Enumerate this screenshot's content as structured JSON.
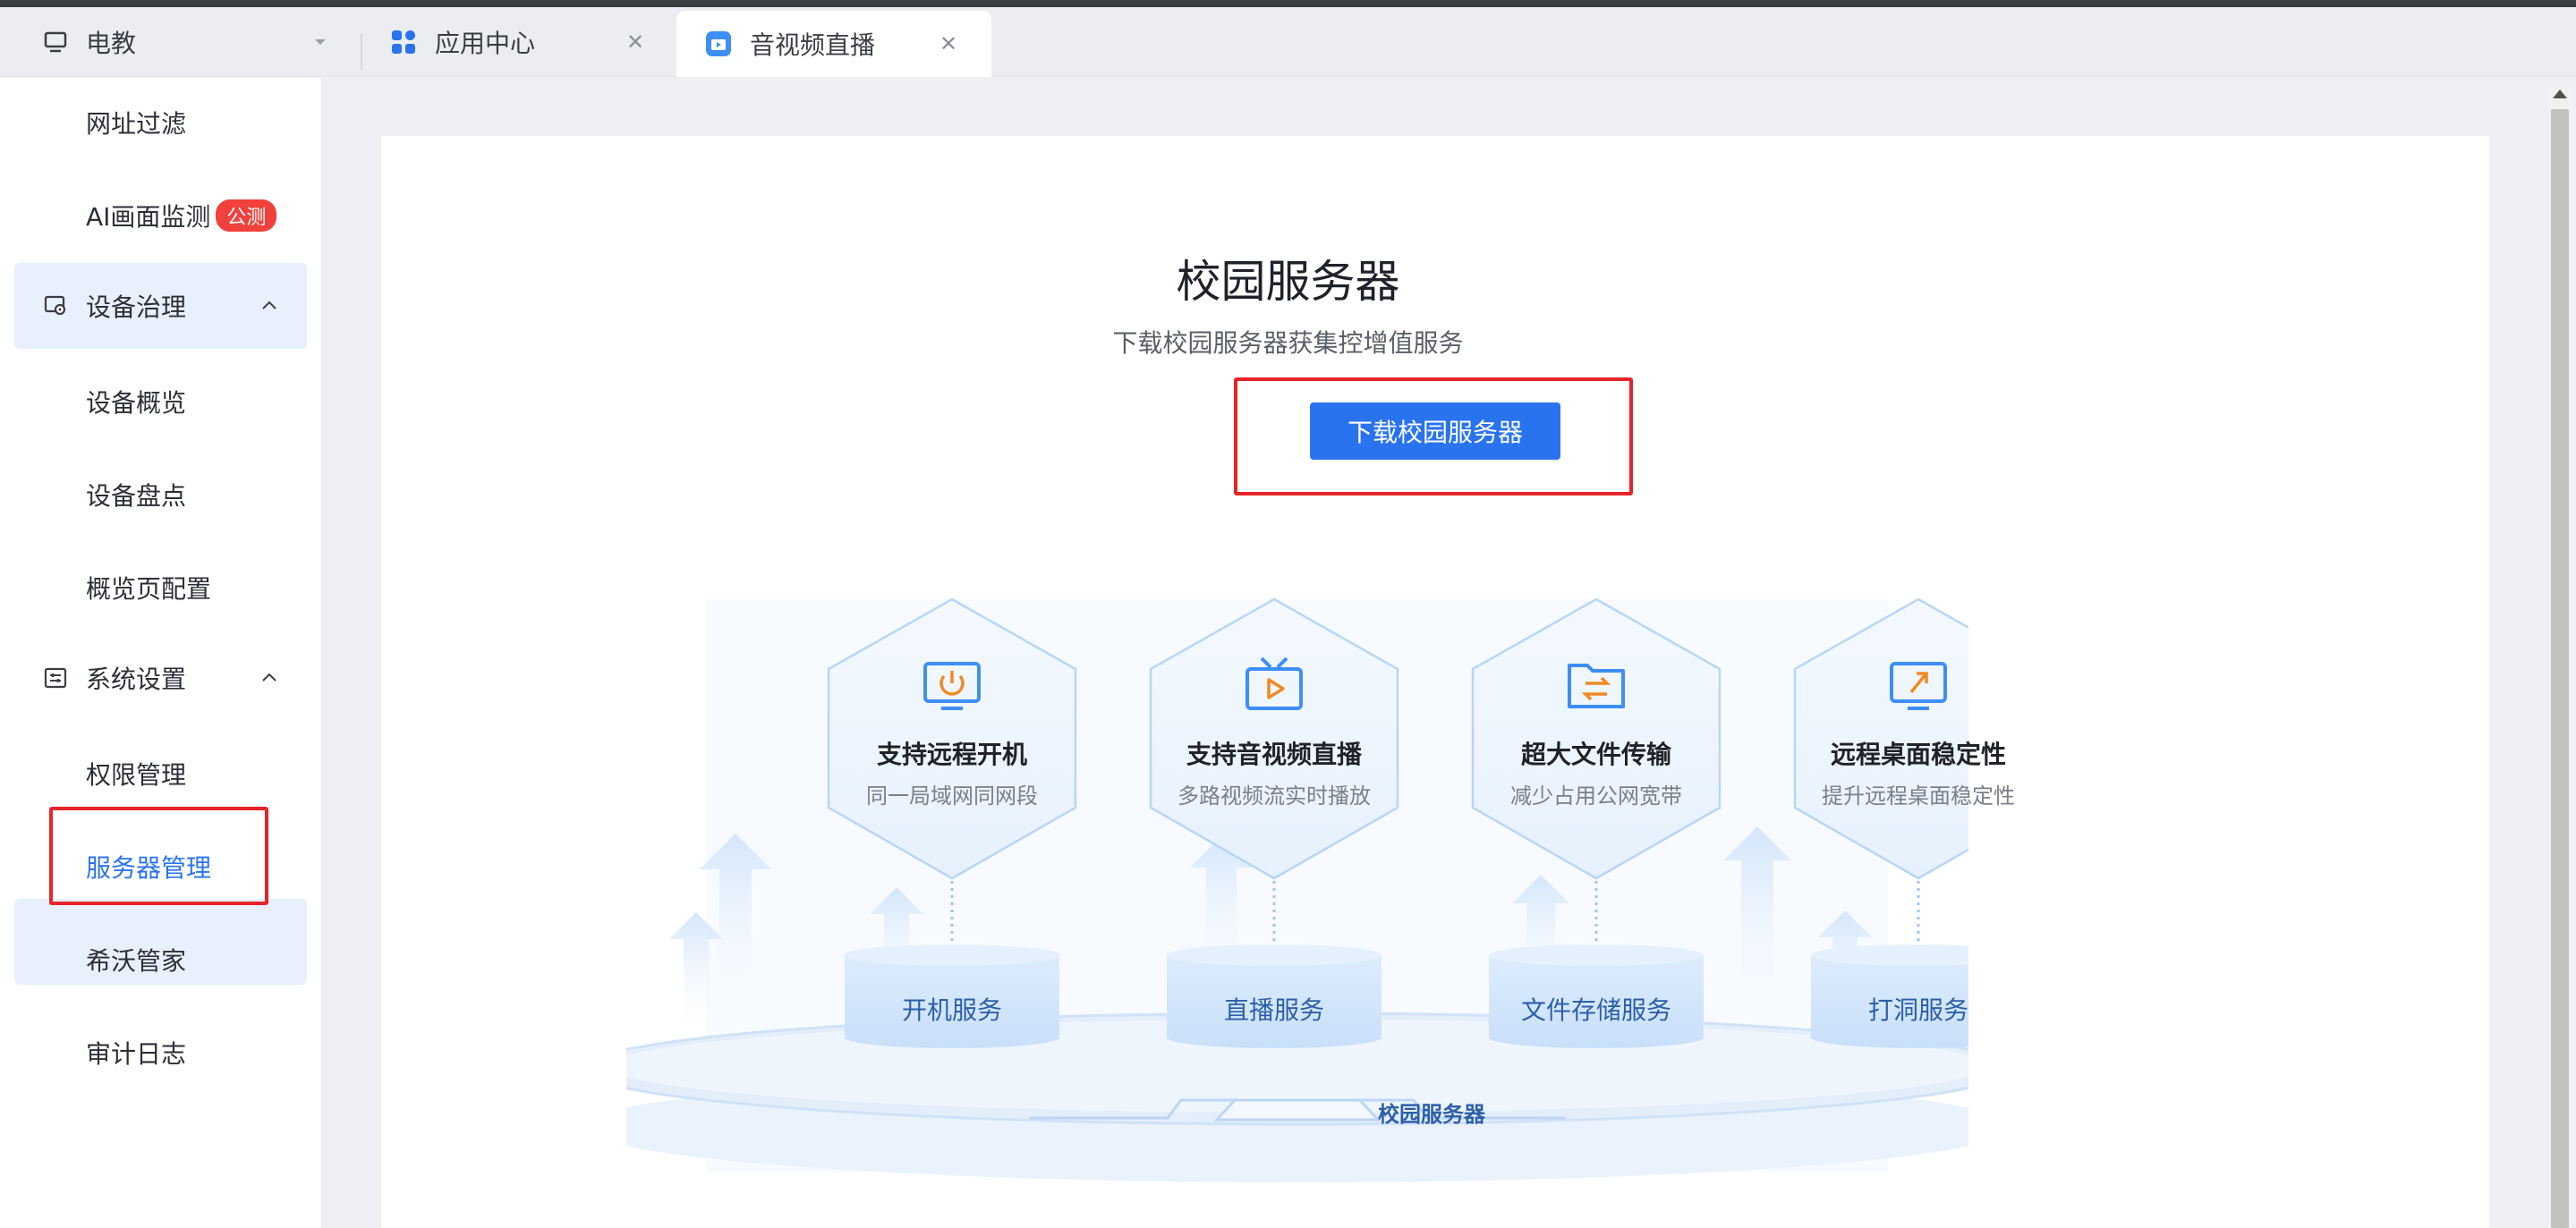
{
  "tabs": [
    {
      "label": "电教",
      "icon": "monitor-icon"
    },
    {
      "label": "应用中心",
      "icon": "grid-icon"
    },
    {
      "label": "音视频直播",
      "icon": "live-icon"
    }
  ],
  "sidebar": {
    "items_top": [
      {
        "label": "网址过滤"
      },
      {
        "label": "AI画面监测",
        "badge": "公测"
      }
    ],
    "group_device": {
      "label": "设备治理"
    },
    "device_items": [
      {
        "label": "设备概览"
      },
      {
        "label": "设备盘点"
      },
      {
        "label": "概览页配置"
      }
    ],
    "group_system": {
      "label": "系统设置"
    },
    "system_items": [
      {
        "label": "权限管理"
      },
      {
        "label": "服务器管理"
      },
      {
        "label": "希沃管家"
      },
      {
        "label": "审计日志"
      }
    ]
  },
  "main": {
    "title": "校园服务器",
    "subtitle": "下载校园服务器获集控增值服务",
    "download_button": "下载校园服务器"
  },
  "features": [
    {
      "title": "支持远程开机",
      "desc": "同一局域网同网段",
      "service": "开机服务",
      "icon": "power-monitor-icon"
    },
    {
      "title": "支持音视频直播",
      "desc": "多路视频流实时播放",
      "service": "直播服务",
      "icon": "tv-play-icon"
    },
    {
      "title": "超大文件传输",
      "desc": "减少占用公网宽带",
      "service": "文件存储服务",
      "icon": "folder-transfer-icon"
    },
    {
      "title": "远程桌面稳定性",
      "desc": "提升远程桌面稳定性",
      "service": "打洞服务",
      "icon": "remote-desktop-icon"
    }
  ],
  "platform_label": "校园服务器",
  "colors": {
    "accent": "#2a73ee",
    "highlight_red": "#e8242a",
    "badge_red": "#f0413c",
    "icon_orange": "#f08a24",
    "selected_bg": "#e8f0fd"
  }
}
